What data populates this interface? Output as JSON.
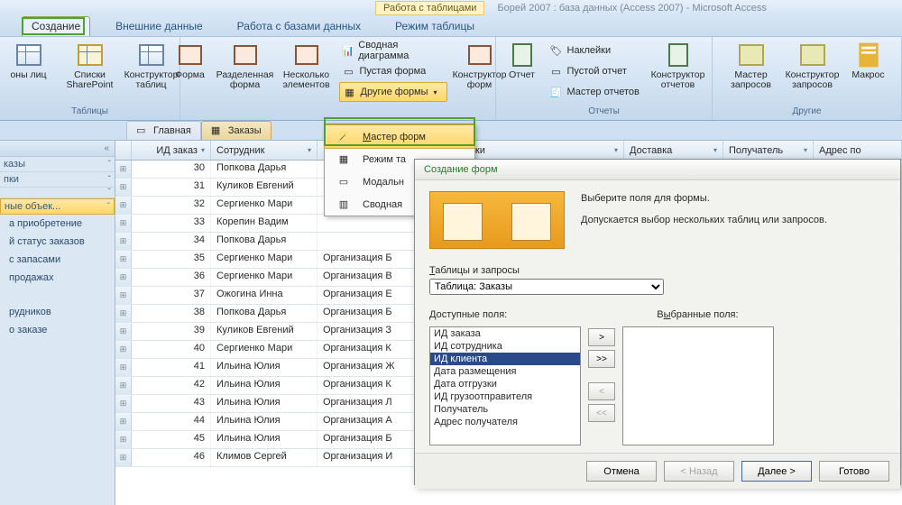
{
  "title": {
    "context": "Работа с таблицами",
    "doc": "Борей 2007 : база данных (Access 2007) - Microsoft Access"
  },
  "ribbon_tabs": {
    "t1": "Создание",
    "t2": "Внешние данные",
    "t3": "Работа с базами данных",
    "t4": "Режим таблицы"
  },
  "ribbon": {
    "g_tables": "Таблицы",
    "btn_templates": "оны лиц",
    "btn_sp": "Списки SharePoint",
    "btn_tabledesign": "Конструктор таблиц",
    "btn_form": "Форма",
    "btn_split": "Разделенная форма",
    "btn_multi": "Несколько элементов",
    "sm_pivot": "Сводная диаграмма",
    "sm_blank": "Пустая форма",
    "sm_other": "Другие формы",
    "btn_formdesign": "Конструктор форм",
    "btn_report": "Отчет",
    "sm_labels": "Наклейки",
    "sm_blankrep": "Пустой отчет",
    "sm_repwiz": "Мастер отчетов",
    "btn_repdesign": "Конструктор отчетов",
    "g_reports": "Отчеты",
    "btn_qwiz": "Мастер запросов",
    "btn_qdesign": "Конструктор запросов",
    "btn_macro": "Макрос",
    "g_other": "Другие"
  },
  "dropdown": {
    "i1": "Мастер форм",
    "i2": "Режим та",
    "i3": "Модальн",
    "i4": "Сводная"
  },
  "doc_tabs": {
    "t1": "Главная",
    "t2": "Заказы"
  },
  "nav": {
    "g1": "казы",
    "g2": "пки",
    "g3": "ные объек...",
    "i1": "а приобретение",
    "i2": "й статус заказов",
    "i3": "с запасами",
    "i4": "продажах",
    "i5": "рудников",
    "i6": "о заказе"
  },
  "cols": {
    "c1": "ИД заказ",
    "c2": "Сотрудник",
    "c3": "",
    "c4": "Дата отгрузки",
    "c5": "Доставка",
    "c6": "Получатель",
    "c7": "Адрес по"
  },
  "rows": [
    {
      "id": "30",
      "emp": "Попкова Дарья",
      "org": ""
    },
    {
      "id": "31",
      "emp": "Куликов Евгений",
      "org": ""
    },
    {
      "id": "32",
      "emp": "Сергиенко Мари",
      "org": ""
    },
    {
      "id": "33",
      "emp": "Корепин Вадим",
      "org": ""
    },
    {
      "id": "34",
      "emp": "Попкова Дарья",
      "org": ""
    },
    {
      "id": "35",
      "emp": "Сергиенко Мари",
      "org": "Организация Б"
    },
    {
      "id": "36",
      "emp": "Сергиенко Мари",
      "org": "Организация В"
    },
    {
      "id": "37",
      "emp": "Ожогина Инна",
      "org": "Организация Е"
    },
    {
      "id": "38",
      "emp": "Попкова Дарья",
      "org": "Организация Б"
    },
    {
      "id": "39",
      "emp": "Куликов Евгений",
      "org": "Организация З"
    },
    {
      "id": "40",
      "emp": "Сергиенко Мари",
      "org": "Организация К"
    },
    {
      "id": "41",
      "emp": "Ильина Юлия",
      "org": "Организация Ж"
    },
    {
      "id": "42",
      "emp": "Ильина Юлия",
      "org": "Организация К"
    },
    {
      "id": "43",
      "emp": "Ильина Юлия",
      "org": "Организация Л"
    },
    {
      "id": "44",
      "emp": "Ильина Юлия",
      "org": "Организация А"
    },
    {
      "id": "45",
      "emp": "Ильина Юлия",
      "org": "Организация Б"
    },
    {
      "id": "46",
      "emp": "Климов Сергей",
      "org": "Организация И"
    }
  ],
  "wizard": {
    "title": "Создание форм",
    "line1": "Выберите поля для формы.",
    "line2": "Допускается выбор нескольких таблиц или запросов.",
    "lbl_tables": "Таблицы и запросы",
    "combo": "Таблица: Заказы",
    "lbl_avail": "Доступные поля:",
    "lbl_sel": "Выбранные поля:",
    "fields": [
      "ИД заказа",
      "ИД сотрудника",
      "ИД клиента",
      "Дата размещения",
      "Дата отгрузки",
      "ИД грузоотправителя",
      "Получатель",
      "Адрес получателя"
    ],
    "btn_add": ">",
    "btn_addall": ">>",
    "btn_rem": "<",
    "btn_remall": "<<",
    "btn_cancel": "Отмена",
    "btn_back": "< Назад",
    "btn_next": "Далее >",
    "btn_finish": "Готово"
  }
}
